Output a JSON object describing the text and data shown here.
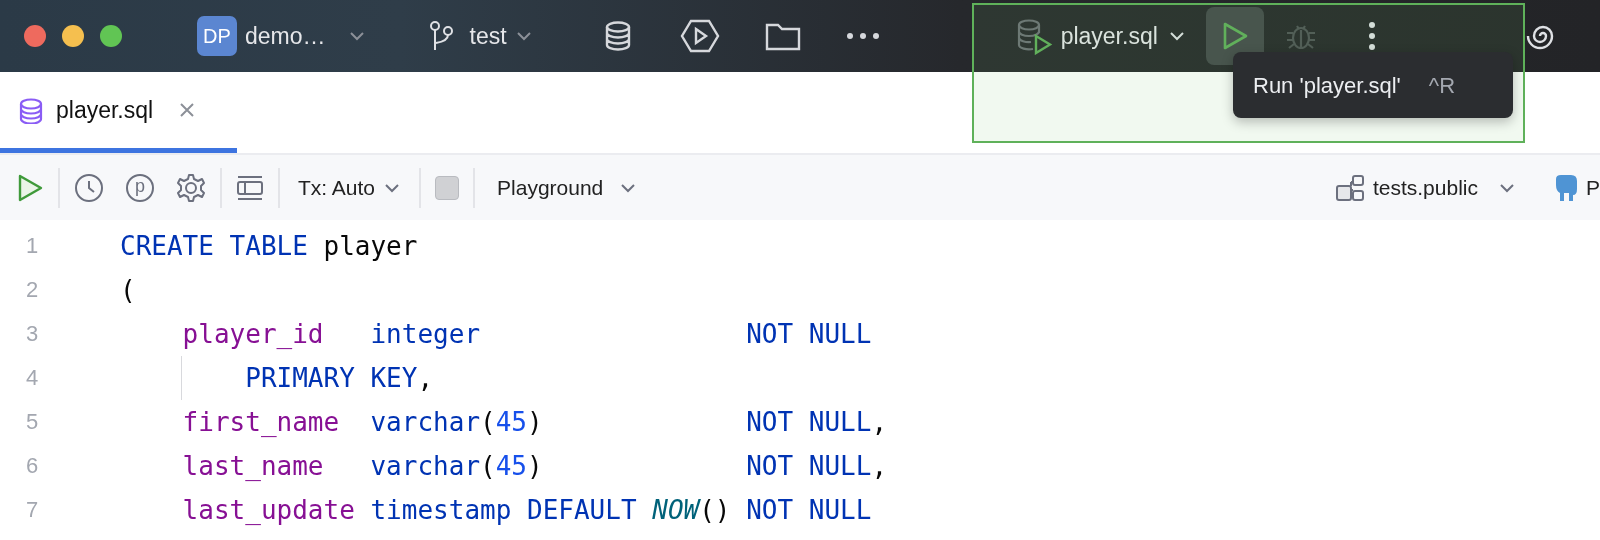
{
  "title_bar": {
    "project": {
      "badge": "DP",
      "name": "demo…"
    },
    "branch": "test",
    "run_config": "player.sql",
    "run_button": {
      "hovered": true
    },
    "debug_button": {
      "disabled": true
    }
  },
  "tooltip": {
    "text": "Run 'player.sql'",
    "shortcut": "^R"
  },
  "tabs": [
    {
      "label": "player.sql",
      "selected": true
    }
  ],
  "toolbar": {
    "params_label": "p",
    "transaction": "Tx: Auto",
    "stop_button": {
      "disabled": true
    },
    "mode": "Playground",
    "schema": "tests.public",
    "datasource": "P"
  },
  "editor": {
    "lines": [
      {
        "number": "1",
        "tokens": [
          {
            "text": "CREATE TABLE",
            "kind": "keyword"
          },
          {
            "text": " player",
            "kind": "plain"
          }
        ]
      },
      {
        "number": "2",
        "tokens": [
          {
            "text": "(",
            "kind": "plain"
          }
        ]
      },
      {
        "number": "3",
        "tokens": [
          {
            "text": "    player_id",
            "kind": "column"
          },
          {
            "text": "   integer",
            "kind": "keyword"
          },
          {
            "text": "                 NOT NULL",
            "kind": "keyword"
          }
        ]
      },
      {
        "number": "4",
        "guide": true,
        "tokens": [
          {
            "text": "        PRIMARY KEY",
            "kind": "keyword"
          },
          {
            "text": ",",
            "kind": "plain"
          }
        ]
      },
      {
        "number": "5",
        "tokens": [
          {
            "text": "    first_name",
            "kind": "column"
          },
          {
            "text": "  varchar",
            "kind": "keyword"
          },
          {
            "text": "(",
            "kind": "plain"
          },
          {
            "text": "45",
            "kind": "number"
          },
          {
            "text": ")",
            "kind": "plain"
          },
          {
            "text": "             NOT NULL",
            "kind": "keyword"
          },
          {
            "text": ",",
            "kind": "plain"
          }
        ]
      },
      {
        "number": "6",
        "tokens": [
          {
            "text": "    last_name",
            "kind": "column"
          },
          {
            "text": "   varchar",
            "kind": "keyword"
          },
          {
            "text": "(",
            "kind": "plain"
          },
          {
            "text": "45",
            "kind": "number"
          },
          {
            "text": ")",
            "kind": "plain"
          },
          {
            "text": "             NOT NULL",
            "kind": "keyword"
          },
          {
            "text": ",",
            "kind": "plain"
          }
        ]
      },
      {
        "number": "7",
        "tokens": [
          {
            "text": "    last_update",
            "kind": "column"
          },
          {
            "text": " timestamp DEFAULT",
            "kind": "keyword"
          },
          {
            "text": " NOW",
            "kind": "function"
          },
          {
            "text": "()",
            "kind": "plain"
          },
          {
            "text": " NOT NULL",
            "kind": "keyword"
          }
        ]
      }
    ]
  }
}
